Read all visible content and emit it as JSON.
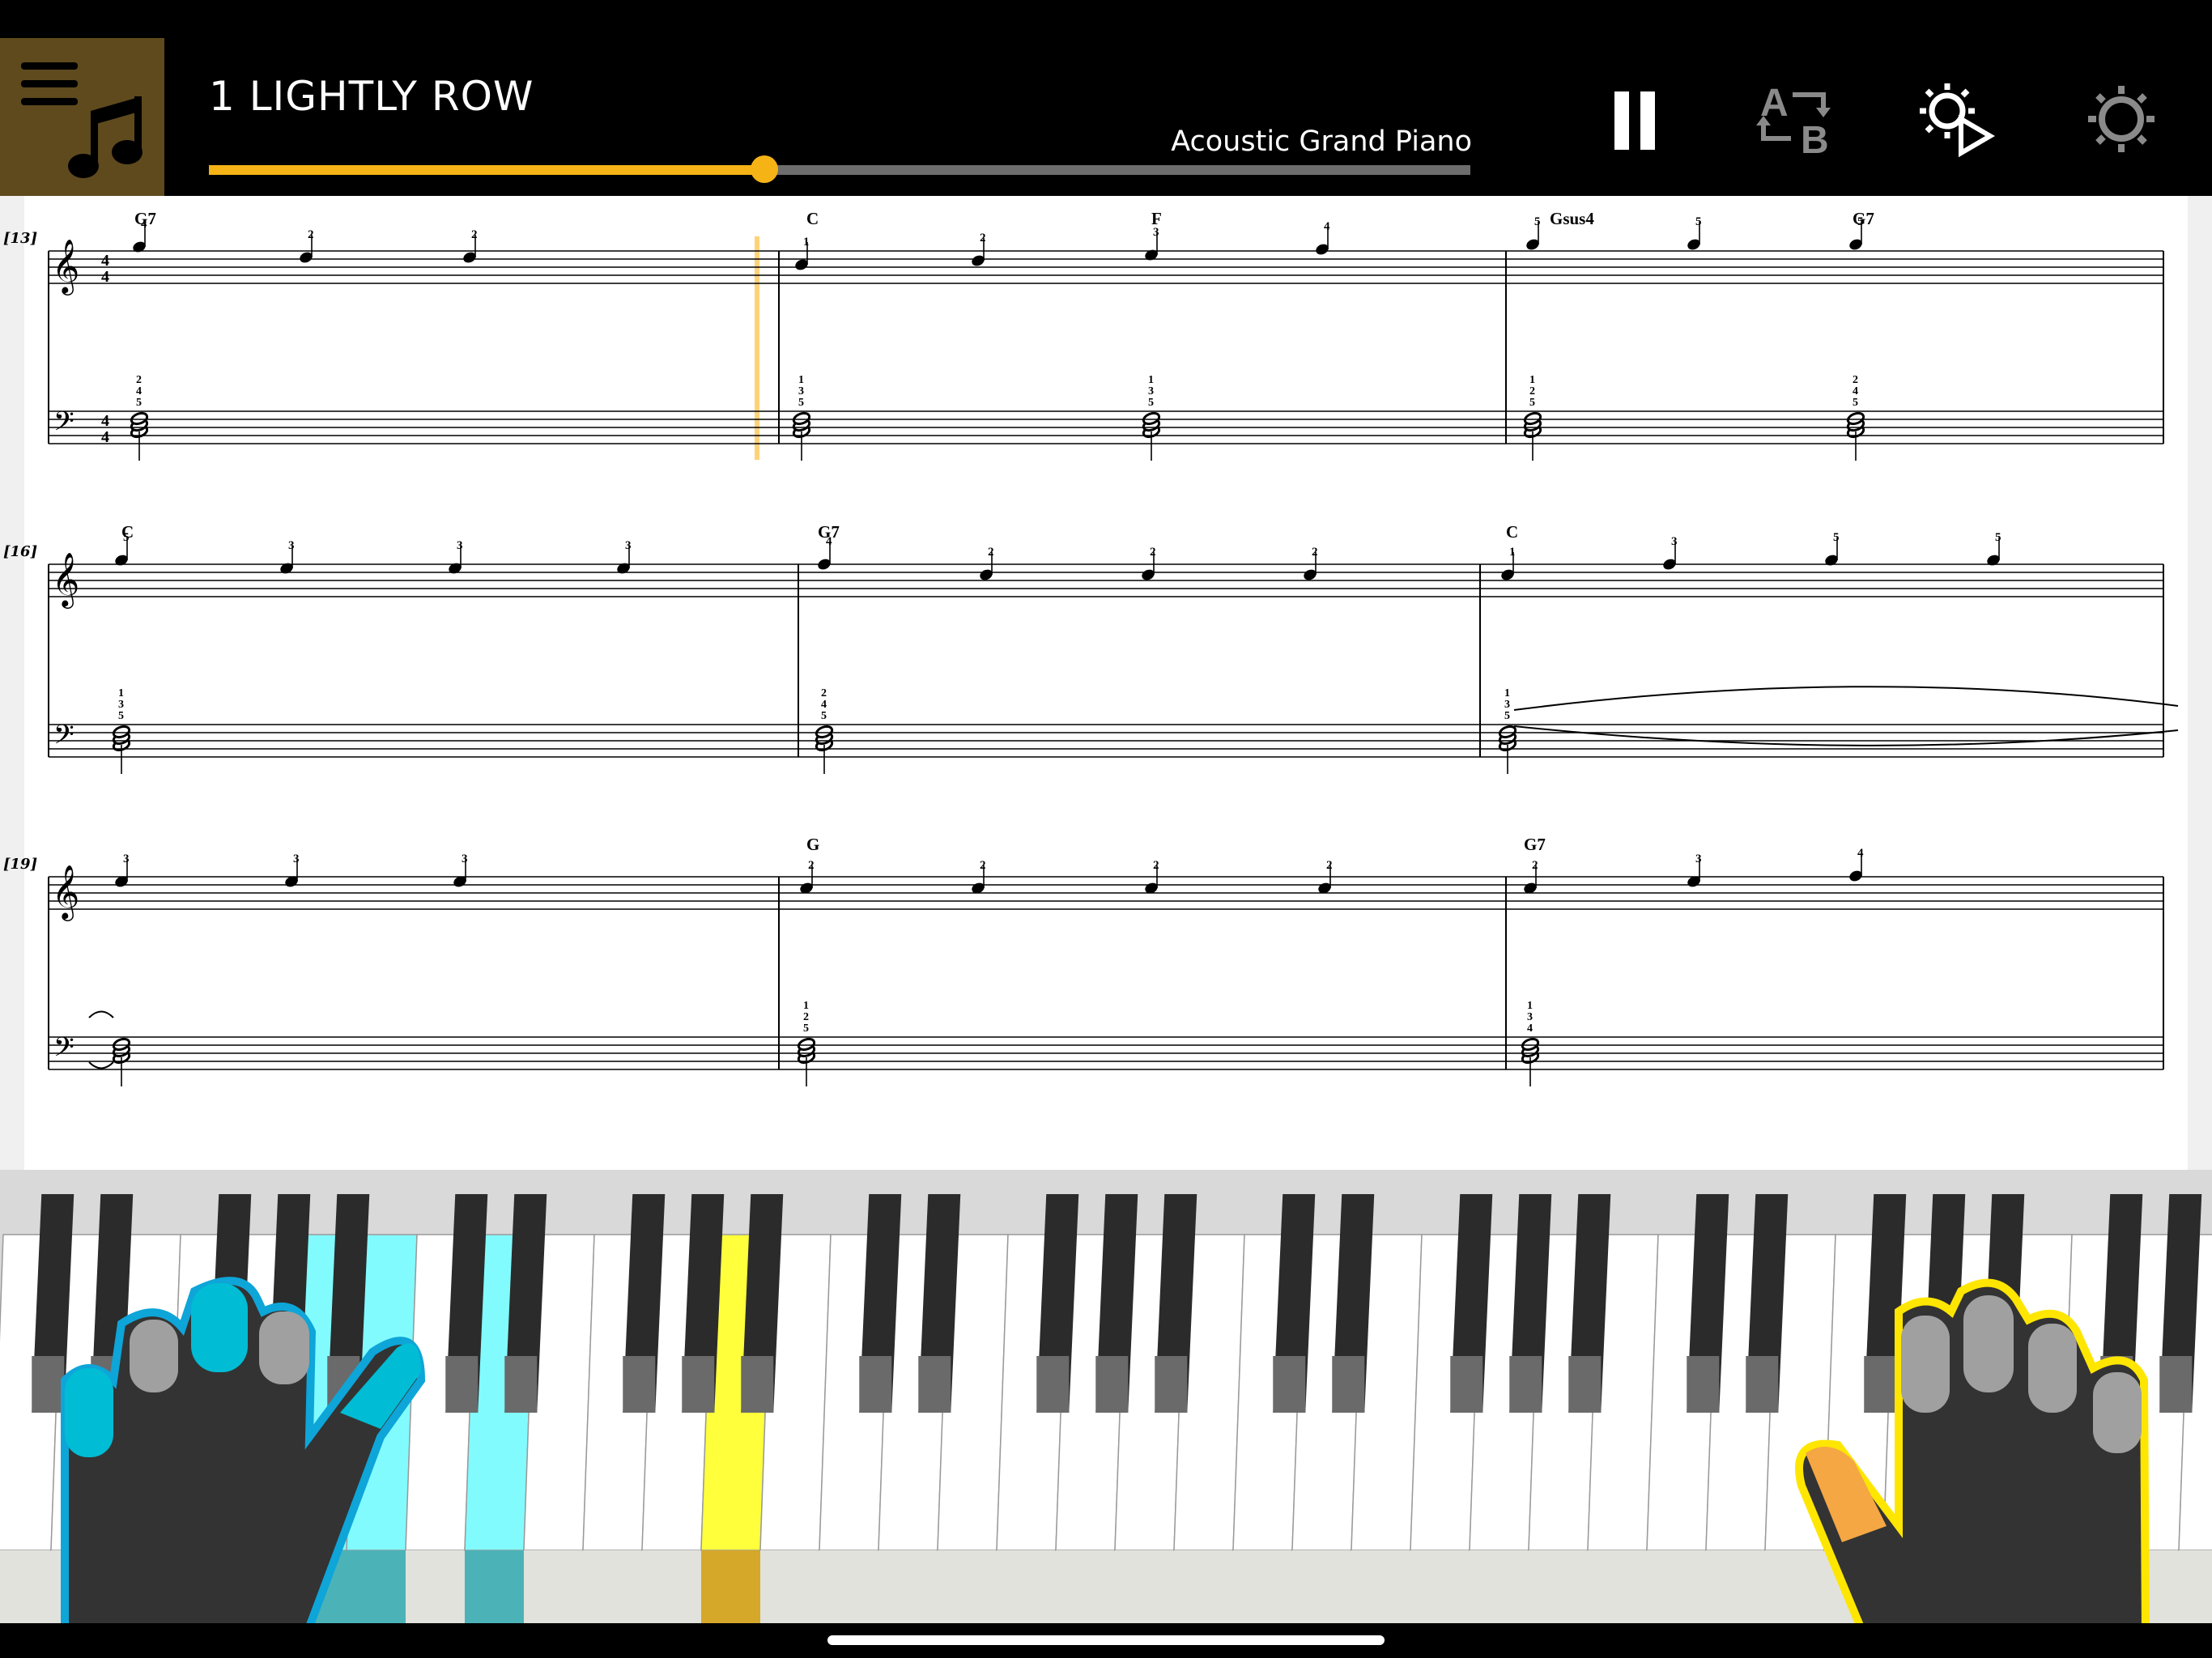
{
  "header": {
    "song_title": "1 LIGHTLY ROW",
    "instrument": "Acoustic Grand Piano",
    "progress": 0.44,
    "menu_icon": "menu-music-icon",
    "buttons": [
      {
        "name": "pause-button",
        "icon": "pause-icon"
      },
      {
        "name": "ab-repeat-button",
        "icon": "ab-repeat-icon"
      },
      {
        "name": "playback-settings-button",
        "icon": "gear-play-icon"
      },
      {
        "name": "settings-button",
        "icon": "gear-icon"
      }
    ]
  },
  "colors": {
    "accent": "#f5b316",
    "left_hand": "#00bcd4",
    "right_hand": "#ffe600",
    "left_hand_key": "#7ffbff",
    "right_hand_key": "#ffff3c"
  },
  "score": {
    "systems": [
      {
        "measure_label": "[13]",
        "chords": [
          "G7",
          "C",
          "F",
          "Gsus4",
          "G7"
        ],
        "treble_fingering": [
          "4",
          "2",
          "2",
          "1",
          "2",
          "3",
          "4",
          "5",
          "5",
          "5"
        ],
        "bass_fingering": [
          "2",
          "4",
          "5",
          "1",
          "3",
          "5",
          "1",
          "3",
          "5",
          "1",
          "2",
          "5",
          "2",
          "4",
          "5"
        ]
      },
      {
        "measure_label": "[16]",
        "chords": [
          "C",
          "G7",
          "C"
        ],
        "treble_fingering": [
          "5",
          "3",
          "3",
          "3",
          "4",
          "2",
          "2",
          "2",
          "1",
          "3",
          "5",
          "5"
        ],
        "bass_fingering": [
          "1",
          "3",
          "5",
          "2",
          "4",
          "5",
          "1",
          "3",
          "5"
        ]
      },
      {
        "measure_label": "[19]",
        "chords": [
          "G",
          "G7"
        ],
        "treble_fingering": [
          "3",
          "3",
          "3",
          "2",
          "2",
          "2",
          "2",
          "2",
          "3",
          "4"
        ],
        "bass_fingering": [
          "1",
          "2",
          "5",
          "1",
          "3",
          "4"
        ]
      }
    ]
  },
  "keyboard": {
    "highlighted_left": [
      "C",
      "E",
      "G"
    ],
    "highlighted_right": [
      "C"
    ]
  }
}
